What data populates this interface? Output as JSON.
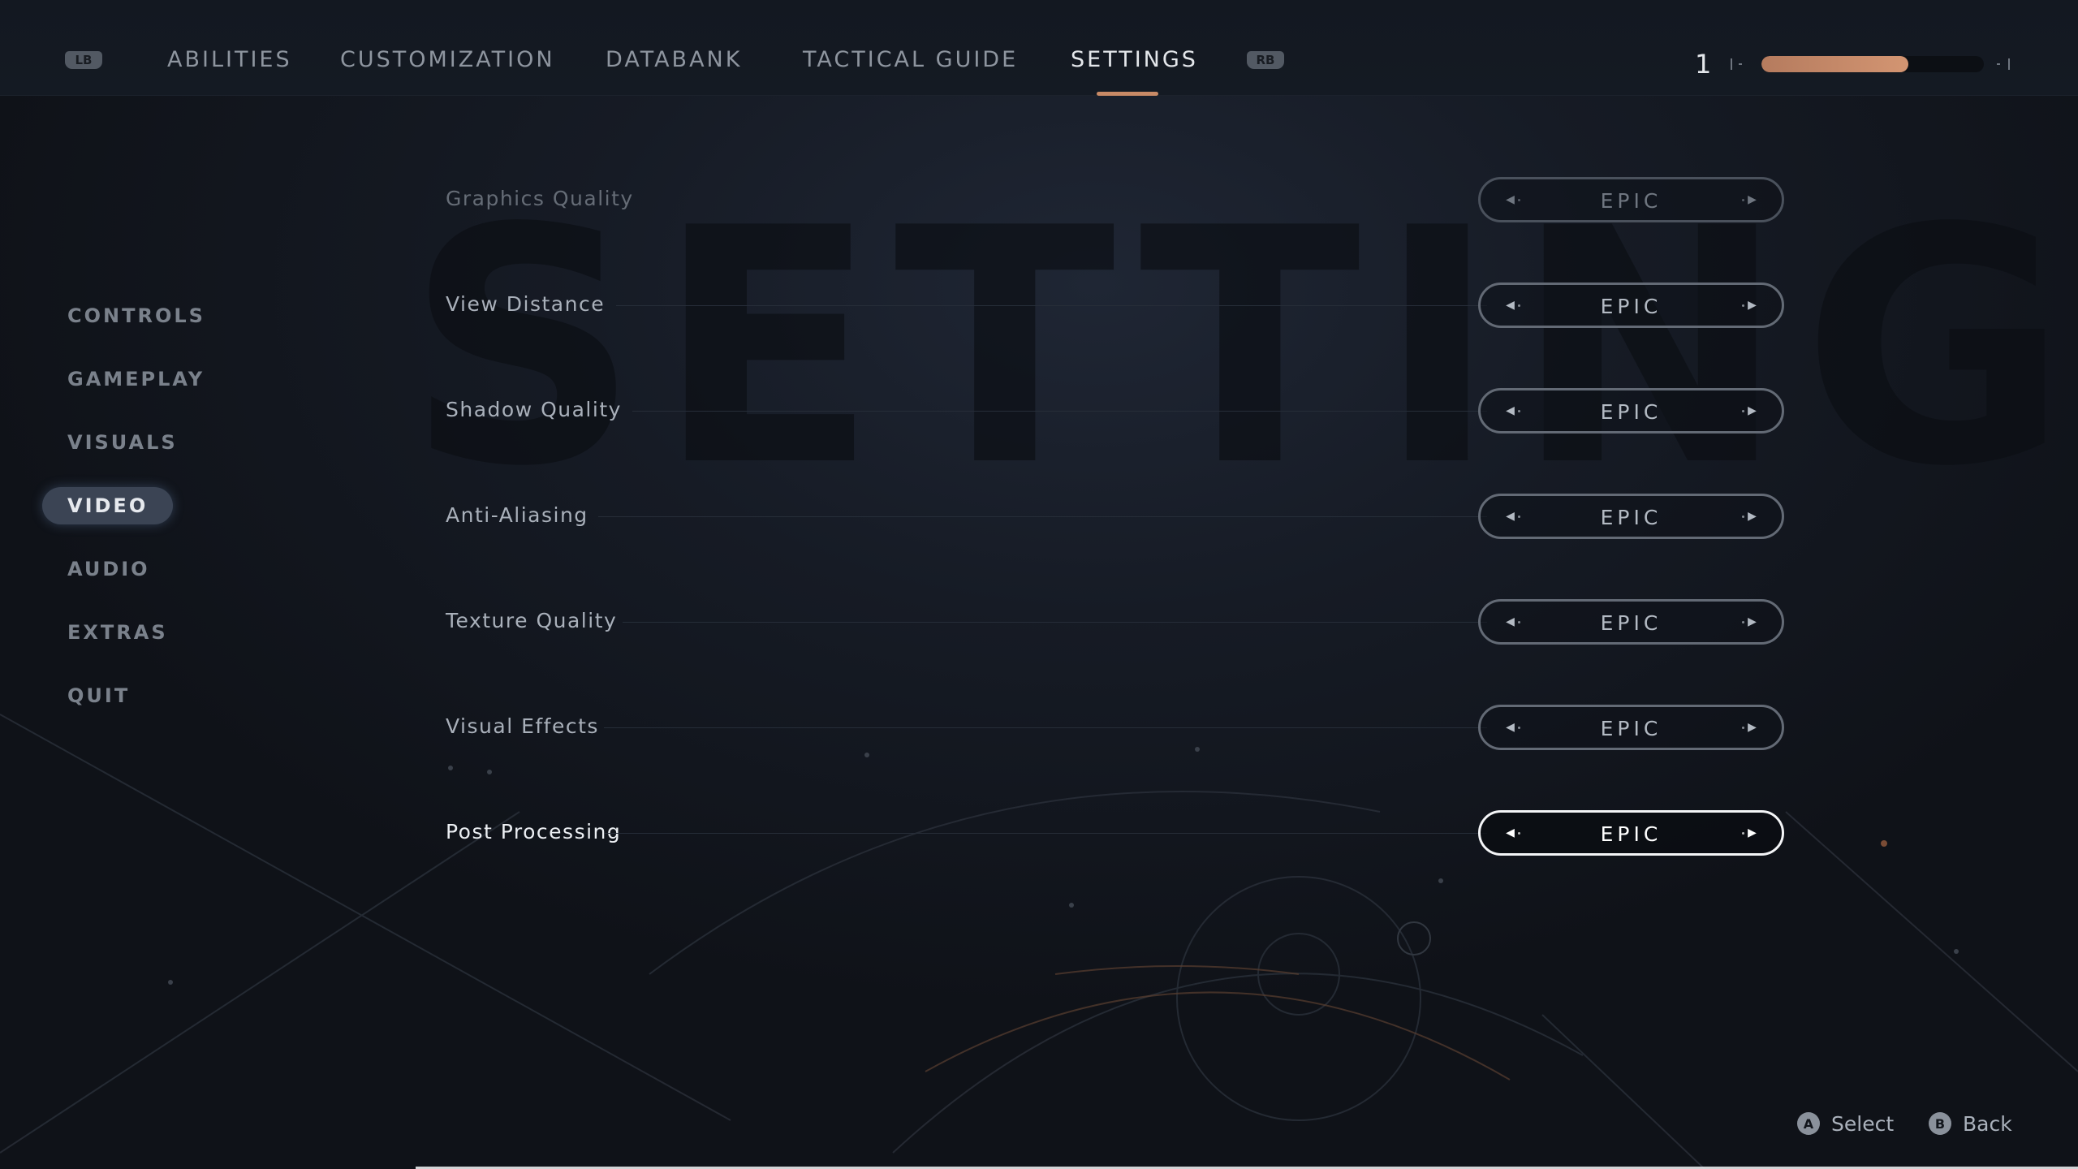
{
  "watermark": "SETTINGS",
  "topbar": {
    "lb_label": "LB",
    "rb_label": "RB",
    "tabs": [
      {
        "label": "ABILITIES",
        "active": false
      },
      {
        "label": "CUSTOMIZATION",
        "active": false
      },
      {
        "label": "DATABANK",
        "active": false
      },
      {
        "label": "TACTICAL GUIDE",
        "active": false
      },
      {
        "label": "SETTINGS",
        "active": true
      }
    ],
    "level": "1",
    "xp_progress": 0.66,
    "accent_color": "#c88a66"
  },
  "sidebar": {
    "items": [
      {
        "label": "CONTROLS",
        "active": false
      },
      {
        "label": "GAMEPLAY",
        "active": false
      },
      {
        "label": "VISUALS",
        "active": false
      },
      {
        "label": "VIDEO",
        "active": true
      },
      {
        "label": "AUDIO",
        "active": false
      },
      {
        "label": "EXTRAS",
        "active": false
      },
      {
        "label": "QUIT",
        "active": false
      }
    ]
  },
  "settings": {
    "rows": [
      {
        "label": "Graphics Quality",
        "value": "EPIC",
        "state": "dim"
      },
      {
        "label": "View Distance",
        "value": "EPIC",
        "state": "normal"
      },
      {
        "label": "Shadow Quality",
        "value": "EPIC",
        "state": "normal"
      },
      {
        "label": "Anti-Aliasing",
        "value": "EPIC",
        "state": "normal"
      },
      {
        "label": "Texture Quality",
        "value": "EPIC",
        "state": "normal"
      },
      {
        "label": "Visual Effects",
        "value": "EPIC",
        "state": "normal"
      },
      {
        "label": "Post Processing",
        "value": "EPIC",
        "state": "focused"
      }
    ]
  },
  "footer": {
    "select": {
      "glyph": "A",
      "label": "Select"
    },
    "back": {
      "glyph": "B",
      "label": "Back"
    }
  },
  "icons": {
    "arrow_left": "triangle-left-icon",
    "arrow_right": "triangle-right-icon"
  }
}
